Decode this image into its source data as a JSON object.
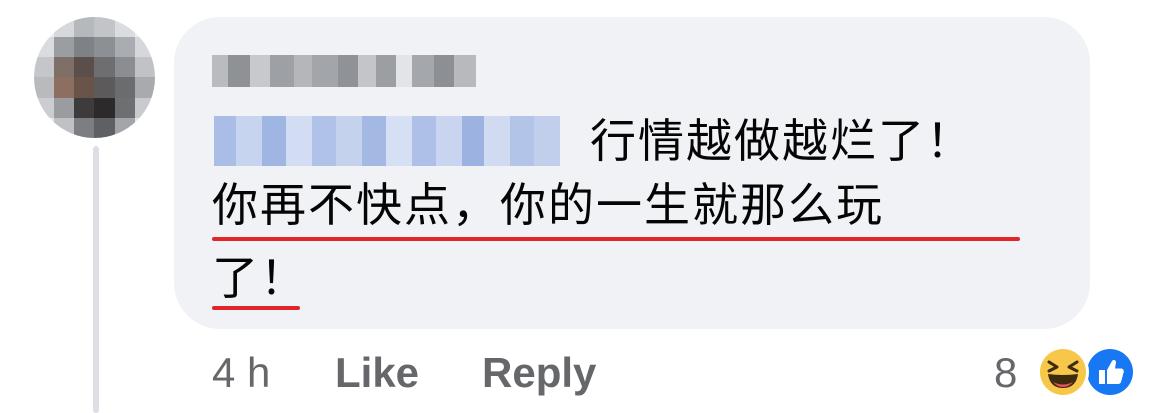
{
  "comment": {
    "author_name": "",
    "mention": "",
    "line1": "行情越做越烂了！",
    "line2": "你再不快点，你的一生就那么玩",
    "line3": "了！"
  },
  "actions": {
    "time": "4 h",
    "like_label": "Like",
    "reply_label": "Reply"
  },
  "reactions": {
    "count": "8",
    "types": [
      "haha-icon",
      "like-icon"
    ]
  },
  "colors": {
    "bubble": "#f0f2f5",
    "underline": "#e0262a",
    "meta_text": "#65676b",
    "like_blue": "#1877f2"
  }
}
